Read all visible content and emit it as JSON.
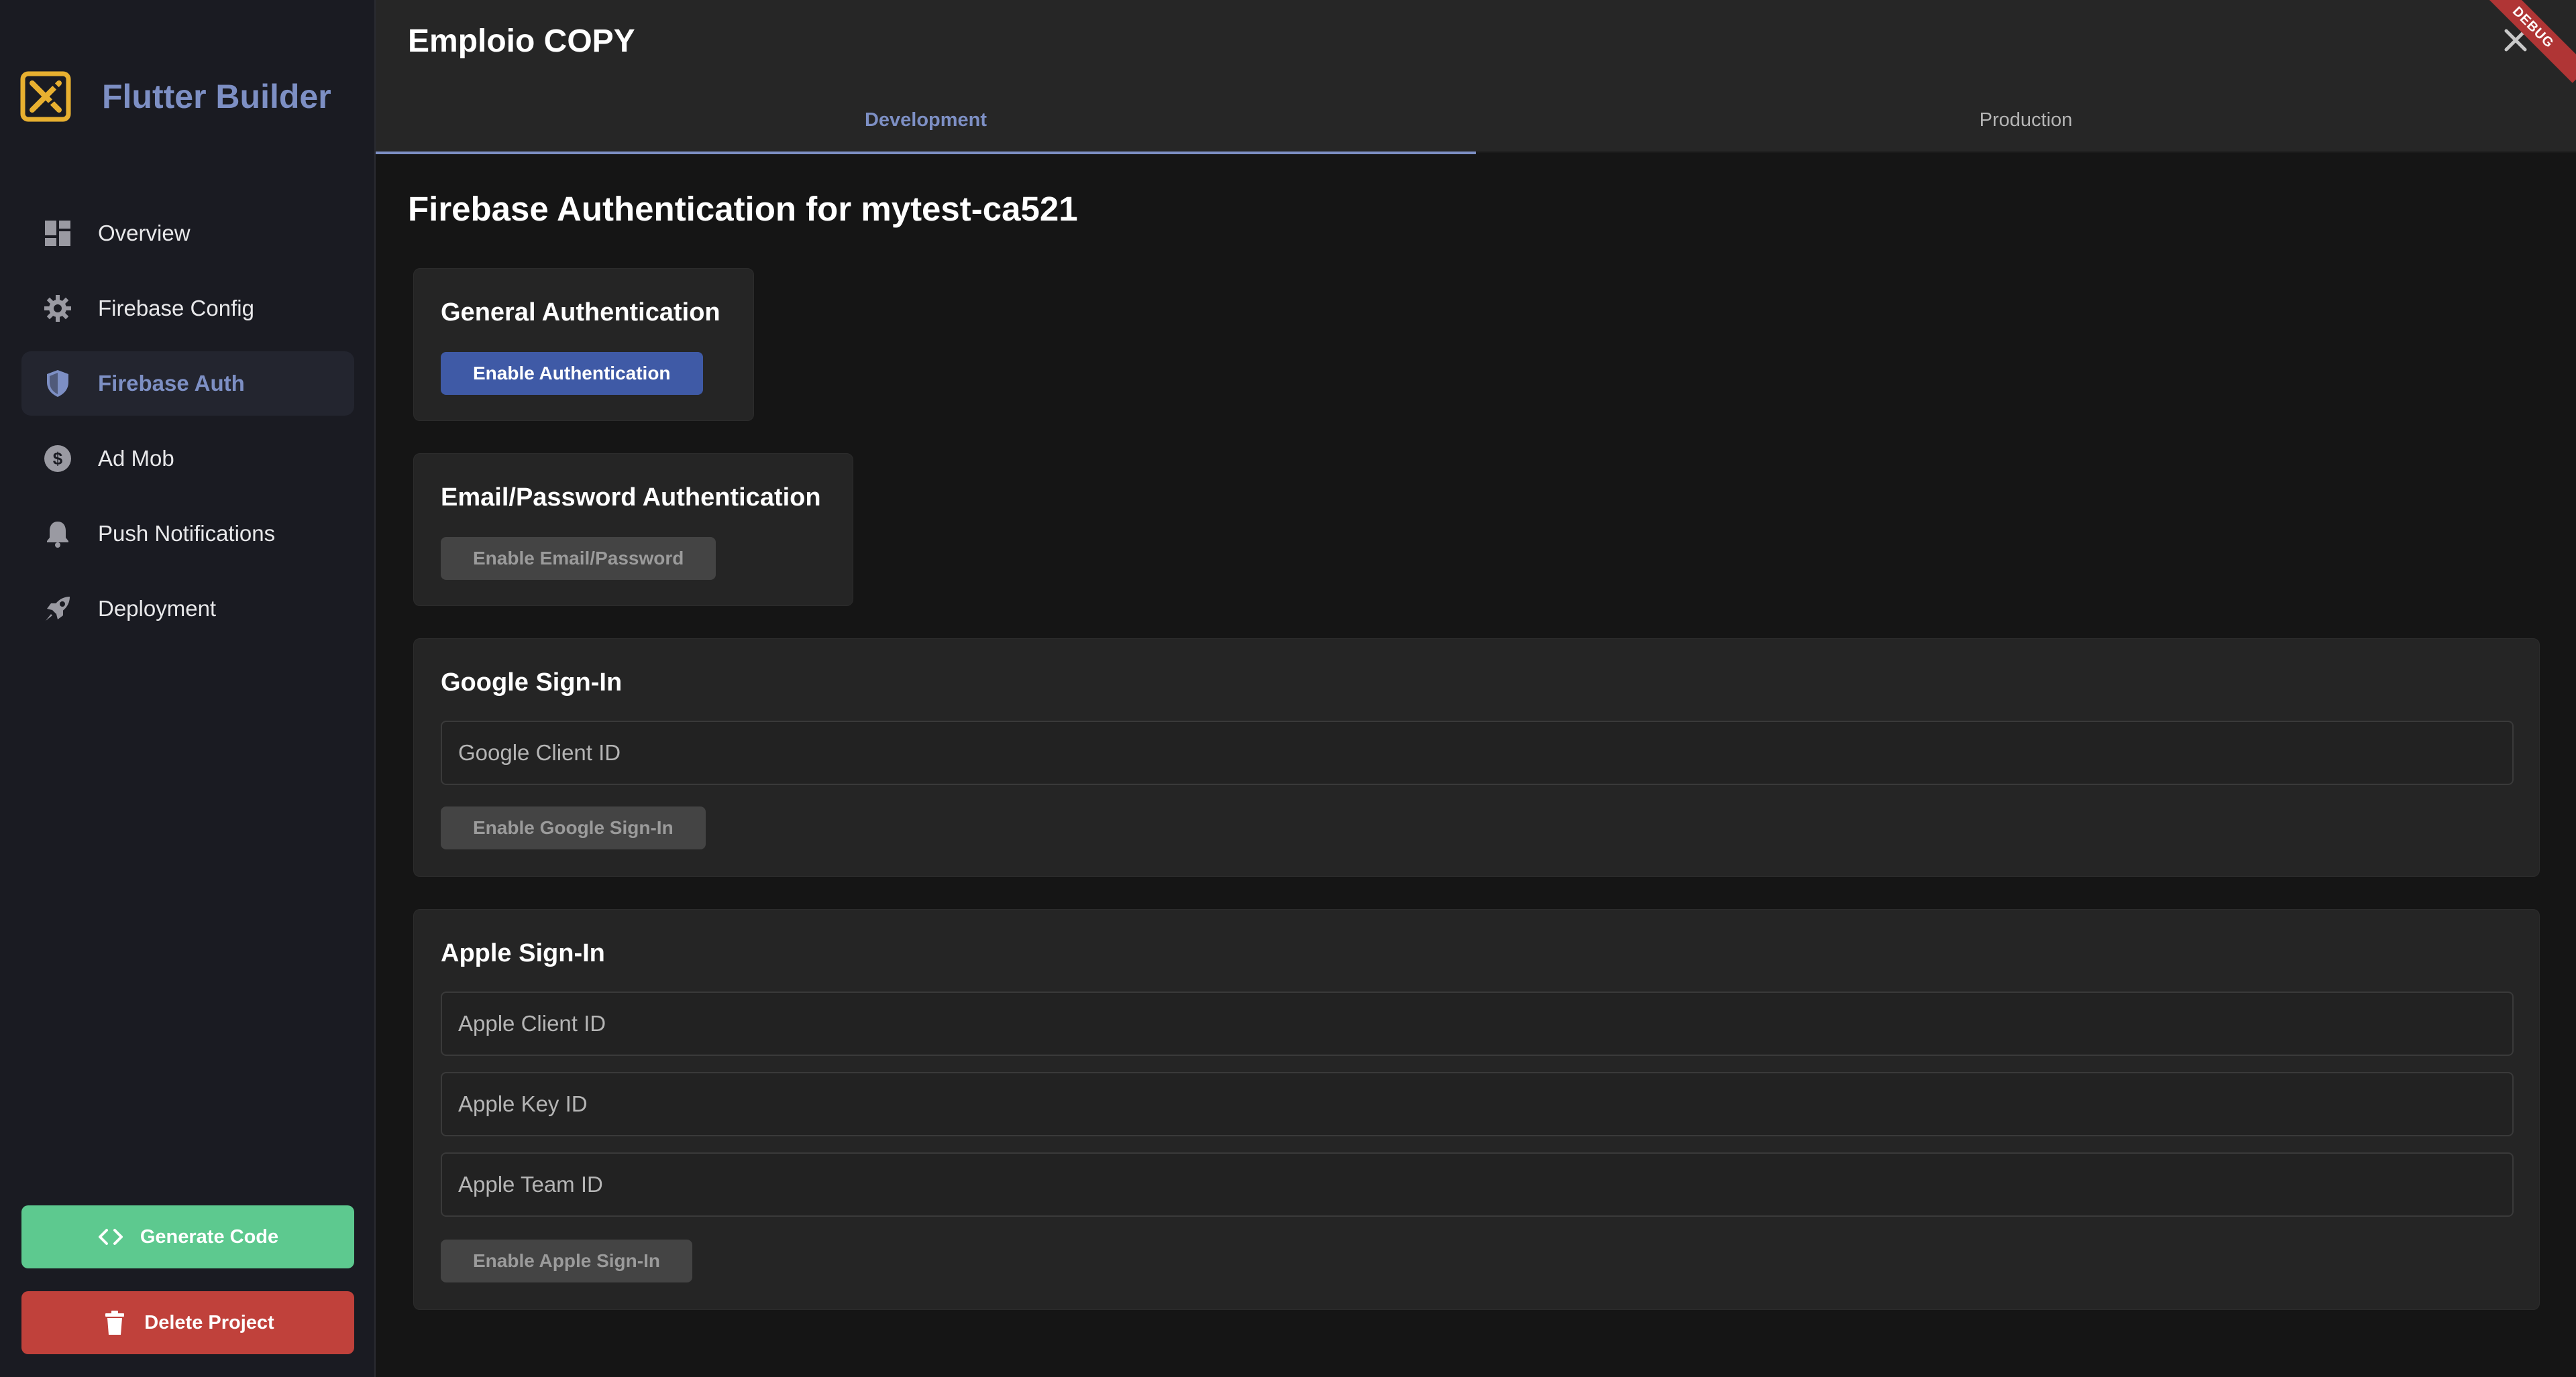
{
  "sidebar": {
    "brand": {
      "name": "Flutter Builder",
      "icon": "flutter-builder-logo-icon"
    },
    "items": [
      {
        "label": "Overview",
        "icon": "dashboard-icon",
        "active": false
      },
      {
        "label": "Firebase Config",
        "icon": "gear-icon",
        "active": false
      },
      {
        "label": "Firebase Auth",
        "icon": "shield-icon",
        "active": true
      },
      {
        "label": "Ad Mob",
        "icon": "dollar-icon",
        "active": false
      },
      {
        "label": "Push Notifications",
        "icon": "bell-icon",
        "active": false
      },
      {
        "label": "Deployment",
        "icon": "rocket-icon",
        "active": false
      }
    ],
    "generate_label": "Generate Code",
    "delete_label": "Delete Project"
  },
  "header": {
    "title": "Emploio COPY",
    "debug_label": "DEBUG",
    "tabs": [
      {
        "label": "Development",
        "active": true
      },
      {
        "label": "Production",
        "active": false
      }
    ]
  },
  "content": {
    "title": "Firebase Authentication for mytest-ca521",
    "general": {
      "title": "General Authentication",
      "button": "Enable Authentication"
    },
    "email": {
      "title": "Email/Password Authentication",
      "button": "Enable Email/Password"
    },
    "google": {
      "title": "Google Sign-In",
      "client_id_placeholder": "Google Client ID",
      "button": "Enable Google Sign-In"
    },
    "apple": {
      "title": "Apple Sign-In",
      "client_id_placeholder": "Apple Client ID",
      "key_id_placeholder": "Apple Key ID",
      "team_id_placeholder": "Apple Team ID",
      "button": "Enable Apple Sign-In"
    }
  },
  "colors": {
    "accent": "#7d8fc4",
    "primary_button": "#3f5aa6",
    "generate": "#5dc98f",
    "delete": "#c0413b",
    "sidebar_bg": "#1a1b22",
    "card_bg": "#252525"
  }
}
